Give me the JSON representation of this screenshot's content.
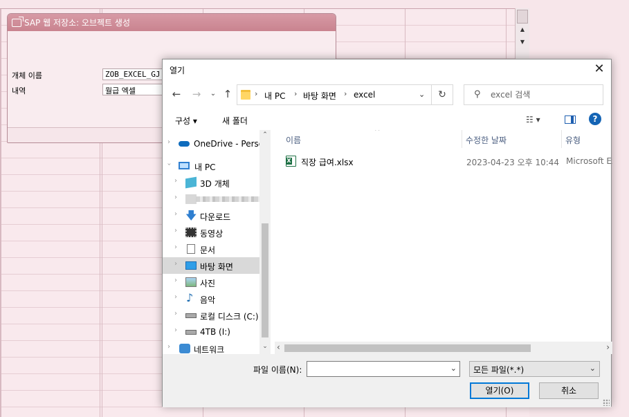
{
  "sap": {
    "title": "SAP 웹 저장소: 오브젝트 생성",
    "object_name_label": "개체 이름",
    "object_name_value": "ZOB_EXCEL_GJ",
    "description_label": "내역",
    "description_value": "월급 엑셀"
  },
  "dialog": {
    "title": "열기",
    "breadcrumbs": [
      "내 PC",
      "바탕 화면",
      "excel"
    ],
    "search_placeholder": "excel 검색",
    "organize_label": "구성 ▾",
    "new_folder_label": "새 폴더",
    "nav": [
      {
        "label": "OneDrive - Persor",
        "icon": "cloud-icon"
      },
      {
        "label": "내 PC",
        "icon": "computer-icon"
      },
      {
        "label": "3D 개체",
        "icon": "cube-icon"
      },
      {
        "label": "",
        "icon": "blurred-item"
      },
      {
        "label": "다운로드",
        "icon": "download-arrow-icon"
      },
      {
        "label": "동영상",
        "icon": "film-icon"
      },
      {
        "label": "문서",
        "icon": "document-icon"
      },
      {
        "label": "바탕 화면",
        "icon": "desktop-icon"
      },
      {
        "label": "사진",
        "icon": "picture-icon"
      },
      {
        "label": "음악",
        "icon": "music-note-icon"
      },
      {
        "label": "로컬 디스크 (C:)",
        "icon": "drive-icon"
      },
      {
        "label": "4TB (I:)",
        "icon": "drive-icon"
      },
      {
        "label": "네트워크",
        "icon": "network-icon"
      }
    ],
    "columns": {
      "name": "이름",
      "modified": "수정한 날짜",
      "type": "유형"
    },
    "files": [
      {
        "name": "직장 급여.xlsx",
        "modified": "2023-04-23 오후 10:44",
        "type": "Microsoft Ex"
      }
    ],
    "filename_label": "파일 이름(N):",
    "filename_value": "",
    "filetype_value": "모든 파일(*.*)",
    "open_label": "열기(O)",
    "cancel_label": "취소"
  }
}
